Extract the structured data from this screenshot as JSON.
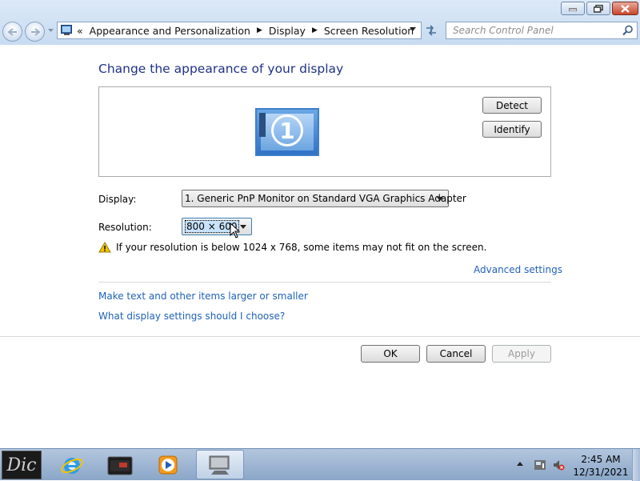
{
  "window": {
    "minimize_icon": "minimize-icon",
    "maximize_icon": "maximize-icon",
    "close_icon": "close-icon"
  },
  "address_bar": {
    "overflow": "«",
    "breadcrumbs": [
      "Appearance and Personalization",
      "Display",
      "Screen Resolution"
    ],
    "search_placeholder": "Search Control Panel"
  },
  "page": {
    "heading": "Change the appearance of your display",
    "monitor_number": "1",
    "detect_label": "Detect",
    "identify_label": "Identify",
    "display_label": "Display:",
    "display_value": "1. Generic PnP Monitor on Standard VGA Graphics Adapter",
    "resolution_label": "Resolution:",
    "resolution_value": "800 × 600",
    "warning_text": "If your resolution is below 1024 x 768, some items may not fit on the screen.",
    "advanced_link": "Advanced settings",
    "link_text_size": "Make text and other items larger or smaller",
    "link_help": "What display settings should I choose?",
    "ok_label": "OK",
    "cancel_label": "Cancel",
    "apply_label": "Apply"
  },
  "taskbar": {
    "start_glyph": "Dic",
    "time": "2:45 AM",
    "date": "12/31/2021"
  },
  "colors": {
    "heading": "#1e3287",
    "link": "#1f62b8",
    "accent": "#3072c5"
  }
}
